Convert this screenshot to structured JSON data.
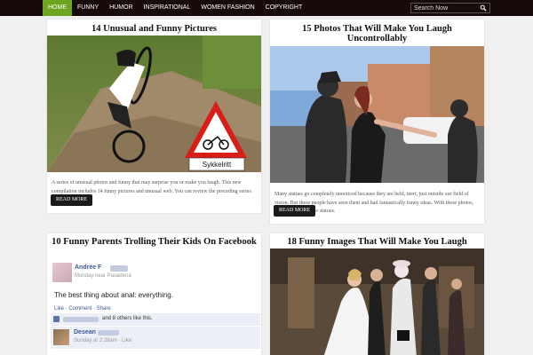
{
  "nav": {
    "items": [
      "Home",
      "Funny",
      "Humor",
      "Inspirational",
      "Women Fashion",
      "Copyright"
    ],
    "active_index": 0
  },
  "search": {
    "placeholder": "Search Now"
  },
  "posts": [
    {
      "title": "14 Unusual and Funny Pictures",
      "excerpt": "A series of unusual photos and funny that may surprise you or make you laugh. This new compilation includes 14 funny pictures and unusual web. You can review the preceding series of unusual images.",
      "button": "Read More",
      "sign_text": "Sykkelritt"
    },
    {
      "title": "15 Photos That Will Make You Laugh Uncontrollably",
      "excerpt": "Many statues go completely unnoticed because they are held, inert, just outside our field of vision. But these people have seen them and had fantastically funny ideas. With these photos, they bring to life the statues.",
      "button": "Read More"
    },
    {
      "title": "10 Funny Parents Trolling Their Kids On Facebook",
      "facebook": {
        "name": "Andrée F",
        "meta": "Monday near Pasadena",
        "post": "The best thing about anal: everything.",
        "actions": "Like · Comment · Share",
        "likes": "and 8 others like this.",
        "commenter": "Desean",
        "comment_meta": "Sunday at 2:28am · Like"
      }
    },
    {
      "title": "18 Funny Images That Will Make You Laugh"
    }
  ],
  "colors": {
    "topbar": "#170a0a",
    "nav_active": "#6ea51f",
    "button": "#1b1b1b",
    "page_bg": "#f0f0f0"
  }
}
